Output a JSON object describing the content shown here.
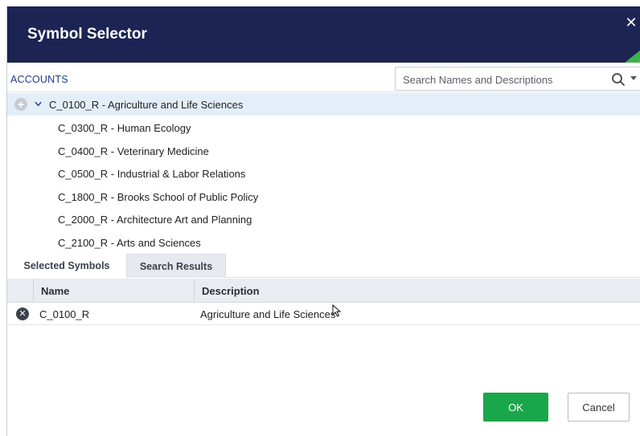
{
  "dialog": {
    "title": "Symbol Selector",
    "close_icon": "close-icon",
    "accent_color": "#3db349",
    "header_color": "#1c2454"
  },
  "accounts": {
    "label": "ACCOUNTS",
    "search_placeholder": "Search Names and Descriptions",
    "search_icon": "search-icon"
  },
  "tree": {
    "items": [
      {
        "label": "C_0100_R - Agriculture and Life Sciences",
        "expanded": true,
        "selected": true
      },
      {
        "label": "C_0300_R - Human Ecology"
      },
      {
        "label": "C_0400_R - Veterinary Medicine"
      },
      {
        "label": "C_0500_R - Industrial & Labor Relations"
      },
      {
        "label": "C_1800_R - Brooks School of Public Policy"
      },
      {
        "label": "C_2000_R - Architecture Art and Planning"
      },
      {
        "label": "C_2100_R - Arts and Sciences"
      }
    ]
  },
  "tabs": [
    {
      "label": "Selected Symbols",
      "active": true
    },
    {
      "label": "Search Results",
      "active": false
    }
  ],
  "grid": {
    "columns": [
      "Name",
      "Description"
    ],
    "rows": [
      {
        "name": "C_0100_R",
        "description": "Agriculture and Life Sciences"
      }
    ]
  },
  "actions": {
    "ok_label": "OK",
    "cancel_label": "Cancel"
  }
}
